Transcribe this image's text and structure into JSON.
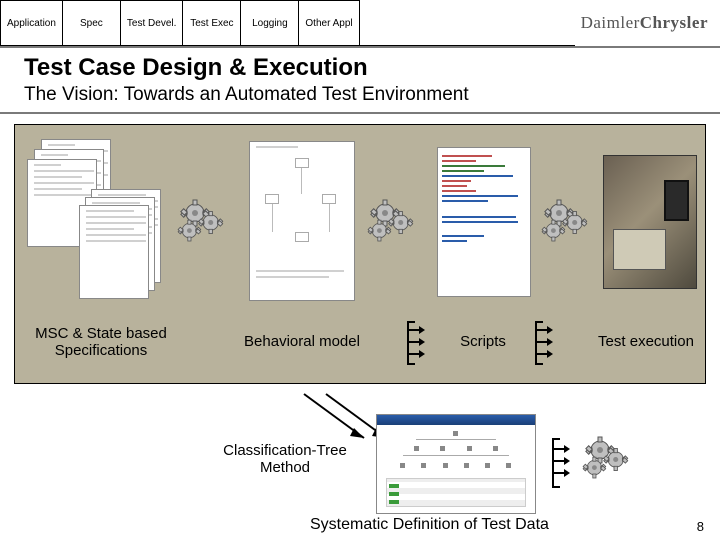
{
  "tabs": [
    "Application",
    "Spec",
    "Test Devel.",
    "Test Exec",
    "Logging",
    "Other Appl"
  ],
  "brand": {
    "part1": "Daimler",
    "part2": "Chrysler"
  },
  "title": "Test Case Design & Execution",
  "subtitle": "The Vision: Towards an Automated Test Environment",
  "flow": {
    "stage1": "MSC & State based\nSpecifications",
    "stage2": "Behavioral model",
    "stage3": "Scripts",
    "stage4": "Test execution"
  },
  "lower": {
    "ctm": "Classification-Tree\nMethod",
    "sysdef": "Systematic Definition of Test Data"
  },
  "page_number": "8"
}
